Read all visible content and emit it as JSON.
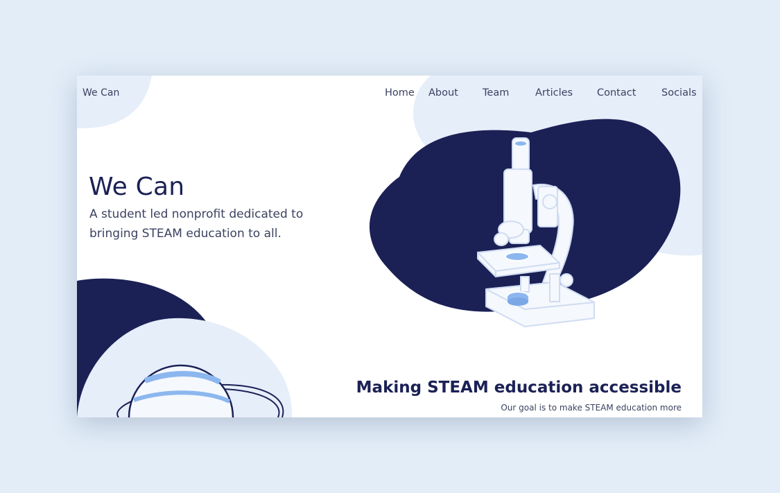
{
  "header": {
    "brand": "We Can"
  },
  "nav": {
    "items": [
      "Home",
      "About",
      "Team",
      "Articles",
      "Contact",
      "Socials"
    ]
  },
  "hero": {
    "title": "We Can",
    "subtitle": "A student led nonprofit dedicated to bringing STEAM education to all."
  },
  "section": {
    "title": "Making STEAM education accessible",
    "body": "Our goal is to make STEAM education more"
  },
  "illustrations": [
    "microscope-illustration",
    "planet-illustration"
  ],
  "colors": {
    "background": "#e2edf8",
    "navy": "#1b2155",
    "light_blue": "#e6eefa",
    "accent_blue": "#8cb7ee",
    "text": "#3c4260"
  }
}
